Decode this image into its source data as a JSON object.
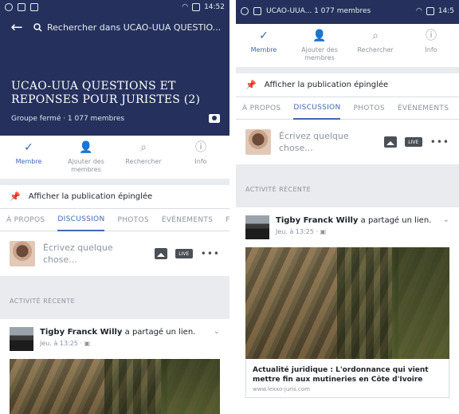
{
  "left": {
    "status_time": "14:52",
    "search_placeholder": "Rechercher dans UCAO-UUA QUESTIO...",
    "group_title": "UCAO-UUA QUESTIONS ET REPONSES POUR JURISTES (2)",
    "group_subtitle": "Groupe fermé · 1 077 membres",
    "actions": [
      {
        "label": "Membre",
        "icon": "check-icon"
      },
      {
        "label": "Ajouter des membres",
        "icon": "add-person-icon"
      },
      {
        "label": "Rechercher",
        "icon": "search-icon"
      },
      {
        "label": "Info",
        "icon": "info-icon"
      }
    ],
    "pinned": "Afficher la publication épinglée",
    "tabs": [
      "À PROPOS",
      "DISCUSSION",
      "PHOTOS",
      "ÉVÉNEMENTS",
      "F"
    ],
    "composer_placeholder": "Écrivez quelque chose...",
    "live_label": "LIVE",
    "section_title": "ACTIVITÉ RÉCENTE",
    "post": {
      "author": "Tigby Franck Willy",
      "action": "a partagé un lien.",
      "time": "Jeu. à 13:25 · "
    }
  },
  "right": {
    "status_time": "14:5",
    "status_text": "UCAO-UUA... 1 077 membres",
    "actions": [
      {
        "label": "Membre",
        "icon": "check-icon"
      },
      {
        "label": "Ajouter des membres",
        "icon": "add-person-icon"
      },
      {
        "label": "Rechercher",
        "icon": "search-icon"
      },
      {
        "label": "Info",
        "icon": "info-icon"
      }
    ],
    "pinned": "Afficher la publication épinglée",
    "tabs": [
      "À PROPOS",
      "DISCUSSION",
      "PHOTOS",
      "ÉVÉNEMENTS"
    ],
    "composer_placeholder": "Écrivez quelque chose...",
    "live_label": "LIVE",
    "section_title": "ACTIVITÉ RÉCENTE",
    "post": {
      "author": "Tigby Franck Willy",
      "action": "a partagé un lien.",
      "time": "Jeu. à 13:25 · ",
      "link_title": "Actualité juridique : L'ordonnance qui vient mettre fin aux mutineries en Côte d'Ivoire",
      "link_domain": "www.lexxo-juris.com"
    }
  },
  "colors": {
    "header": "#25315c",
    "accent": "#4267b2",
    "divider": "#e9ebee"
  }
}
